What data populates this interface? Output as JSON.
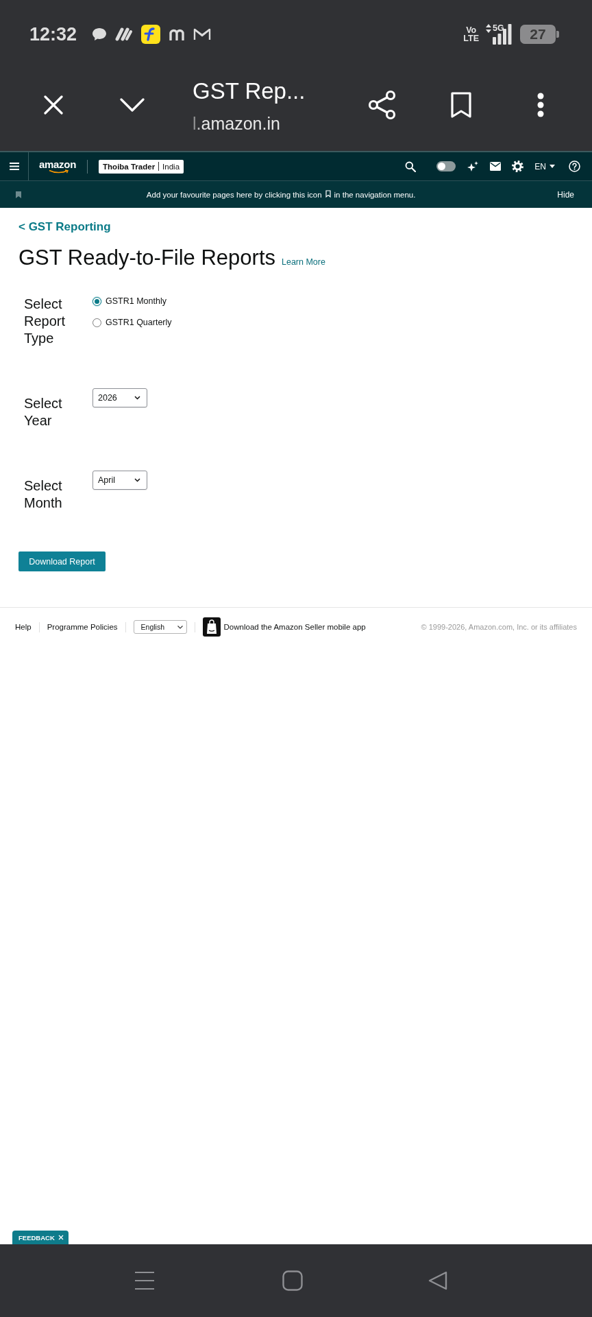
{
  "status_bar": {
    "time": "12:32",
    "volte_top": "Vo",
    "volte_bottom": "LTE",
    "network": "5G",
    "battery": "27"
  },
  "browser_bar": {
    "title": "GST Rep...",
    "url": "l.amazon.in"
  },
  "nav": {
    "logo": "amazon",
    "store": {
      "name": "Thoiba Trader",
      "region": "India"
    },
    "toggle": {
      "on": false
    },
    "language": "EN"
  },
  "bookmark_bar": {
    "text_before": "Add your favourite pages here by clicking this icon",
    "text_after": "in the navigation menu.",
    "action": "Hide"
  },
  "breadcrumb": "< GST Reporting",
  "page": {
    "title": "GST Ready-to-File Reports",
    "link": "Learn More"
  },
  "form": [
    {
      "kind": "radio",
      "label": "Select Report Type",
      "options": [
        {
          "label": "GSTR1 Monthly",
          "selected": true
        },
        {
          "label": "GSTR1 Quarterly",
          "selected": false
        }
      ]
    },
    {
      "kind": "select",
      "label": "Select Year",
      "value": "2026"
    },
    {
      "kind": "select",
      "label": "Select Month",
      "value": "April"
    }
  ],
  "primary_button": "Download Report",
  "footer": {
    "links": [
      "Help",
      "Programme Policies"
    ],
    "language": "English",
    "app_promo": "Download the Amazon Seller mobile app",
    "copyright": "© 1999-2026, Amazon.com, Inc. or its affiliates"
  },
  "feedback": {
    "label": "FEEDBACK"
  }
}
